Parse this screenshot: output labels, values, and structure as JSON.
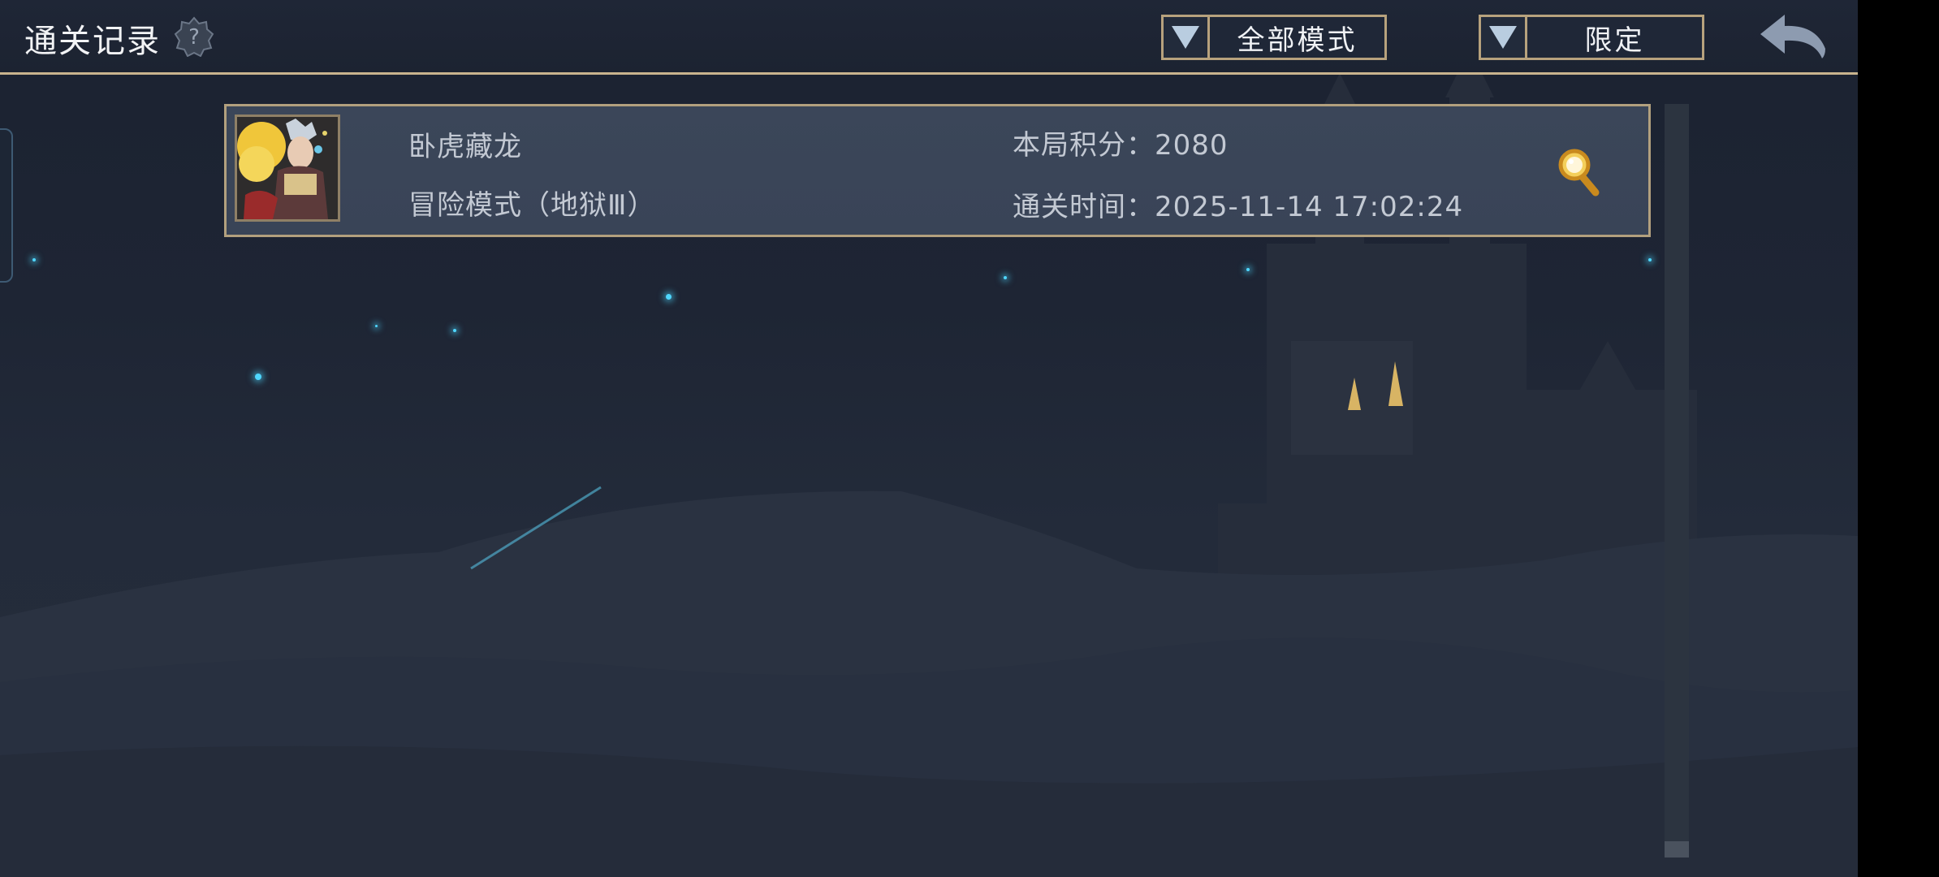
{
  "header": {
    "title": "通关记录",
    "help_icon": "question-badge-icon",
    "mode_filter": {
      "selected": "全部模式",
      "icon": "triangle-down-icon"
    },
    "limit_filter": {
      "selected": "限定",
      "icon": "triangle-down-icon"
    },
    "back_icon": "back-arrow-icon"
  },
  "records": [
    {
      "avatar_icon": "hero-portrait-icon",
      "name": "卧虎藏龙",
      "mode": "冒险模式（地狱Ⅲ）",
      "score": "本局积分：2080",
      "time": "通关时间：2025-11-14 17:02:24",
      "action_icon": "magnifier-icon"
    }
  ],
  "colors": {
    "accent_gold": "#b7a27d",
    "header_bg": "#1f2636",
    "card_bg": "#3b4659",
    "star_cyan": "#4fd7ff"
  }
}
